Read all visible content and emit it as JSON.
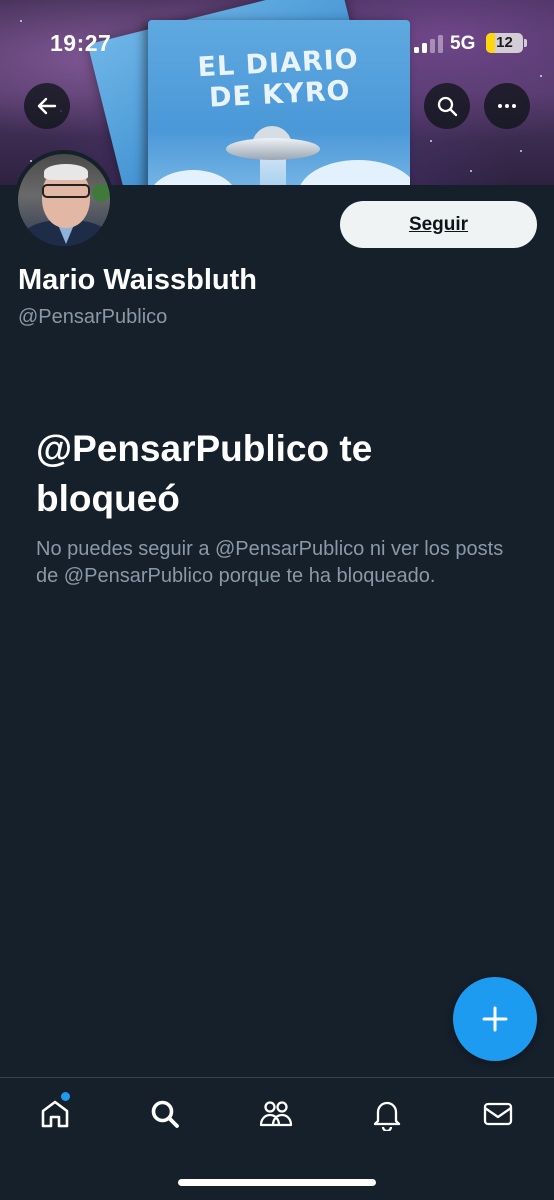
{
  "status_bar": {
    "time": "19:27",
    "network": "5G",
    "battery_level": "12"
  },
  "banner": {
    "book_title_line1": "EL DIARIO",
    "book_title_line2": "DE KYRO"
  },
  "profile": {
    "name": "Mario Waissbluth",
    "handle": "@PensarPublico",
    "follow_label": "Seguir"
  },
  "blocked": {
    "title": "@PensarPublico te bloqueó",
    "description": "No puedes seguir a @PensarPublico ni ver los posts de @PensarPublico porque te ha bloqueado."
  },
  "icons": {
    "back": "arrow-left-icon",
    "search": "search-icon",
    "more": "more-horizontal-icon",
    "compose": "plus-icon",
    "nav": [
      "home-icon",
      "search-icon",
      "communities-icon",
      "notifications-bell-icon",
      "messages-mail-icon"
    ]
  },
  "colors": {
    "background": "#15202b",
    "accent": "#1d9bf0",
    "secondary_text": "#8b98a5",
    "follow_button_bg": "#eff3f4"
  }
}
